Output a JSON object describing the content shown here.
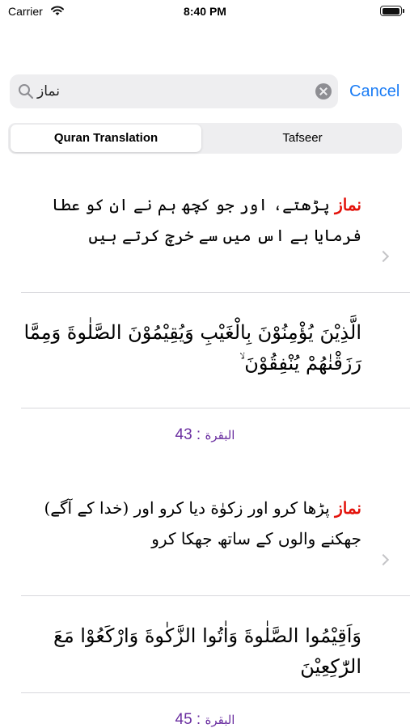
{
  "status_bar": {
    "carrier": "Carrier",
    "time": "8:40 PM",
    "battery_level": 1.0
  },
  "search": {
    "query": "نماز",
    "cancel_label": "Cancel"
  },
  "segments": {
    "active": "Quran Translation",
    "inactive": "Tafseer"
  },
  "colors": {
    "accent": "#1a7cf5",
    "highlight": "#e3120b",
    "reference": "#6a2ea0"
  },
  "results": [
    {
      "keyword": "نماز",
      "translation_rest": " پڑھتے، اور جو کچھ ہم نے ان کو عطا فرمایا ہے اس میں سے خرچ کرتے ہیں",
      "arabic": "الَّذِيْنَ يُؤْمِنُوْنَ بِالْغَيْبِ وَيُقِيْمُوْنَ الصَّلٰوةَ وَمِمَّا رَزَقْنٰهُمْ يُنْفِقُوْنَ ۙ",
      "surah": "البقرة",
      "separator": " : ",
      "verse": "43"
    },
    {
      "keyword": "نماز",
      "translation_rest": " پڑھا کرو اور زکوٰة دیا کرو اور (خدا کے آگے) جھکنے والوں کے ساتھ جھکا کرو",
      "arabic": "وَاَقِيْمُوا الصَّلٰوةَ وَاٰتُوا الزَّكٰوةَ وَارْكَعُوْا مَعَ الرّٰكِعِيْنَ",
      "surah": "البقرة",
      "separator": " : ",
      "verse": "45"
    }
  ]
}
